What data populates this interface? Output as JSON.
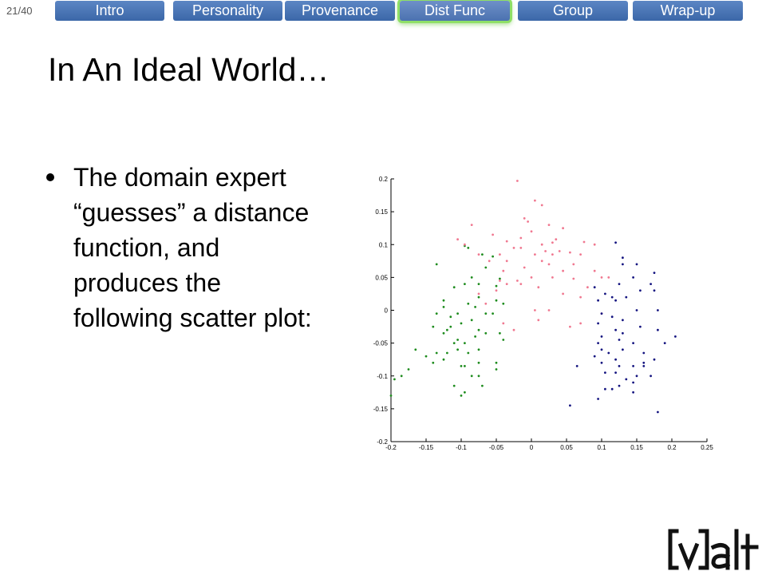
{
  "page_indicator": "21/40",
  "nav": {
    "tabs": [
      {
        "label": "Intro",
        "active": false
      },
      {
        "label": "Personality",
        "active": false
      },
      {
        "label": "Provenance",
        "active": false
      },
      {
        "label": "Dist Func",
        "active": true
      },
      {
        "label": "Group",
        "active": false
      },
      {
        "label": "Wrap-up",
        "active": false
      }
    ]
  },
  "slide": {
    "title": "In An Ideal World…",
    "bullets": [
      {
        "text": "The domain expert “guesses” a distance function, and produces the following scatter plot:"
      }
    ]
  },
  "logo": {
    "text": "[v]alt"
  },
  "colors": {
    "nav_tab": "#4a75b8",
    "nav_active_glow": "#8fdf66",
    "series_green": "#1e8c1e",
    "series_pink": "#f07890",
    "series_navy": "#141480"
  },
  "chart_data": {
    "type": "scatter",
    "title": "",
    "xlabel": "",
    "ylabel": "",
    "xlim": [
      -0.2,
      0.25
    ],
    "ylim": [
      -0.2,
      0.2
    ],
    "xticks": [
      "-0.2",
      "-0.15",
      "-0.1",
      "-0.05",
      "0",
      "0.05",
      "0.1",
      "0.15",
      "0.2",
      "0.25"
    ],
    "yticks": [
      "0.2",
      "0.15",
      "0.1",
      "0.05",
      "0",
      "-0.05",
      "-0.1",
      "-0.15",
      "-0.2"
    ],
    "grid": false,
    "series": [
      {
        "color": "#1e8c1e",
        "points": [
          [
            -0.095,
            0.098
          ],
          [
            -0.09,
            0.095
          ],
          [
            -0.07,
            0.085
          ],
          [
            -0.055,
            0.082
          ],
          [
            -0.135,
            0.07
          ],
          [
            -0.085,
            0.05
          ],
          [
            -0.045,
            0.048
          ],
          [
            -0.095,
            0.04
          ],
          [
            -0.075,
            0.04
          ],
          [
            -0.11,
            0.035
          ],
          [
            -0.05,
            0.037
          ],
          [
            -0.075,
            0.02
          ],
          [
            -0.08,
            0.005
          ],
          [
            -0.09,
            0.01
          ],
          [
            -0.125,
            0.015
          ],
          [
            -0.05,
            0.015
          ],
          [
            -0.04,
            0.01
          ],
          [
            -0.105,
            -0.005
          ],
          [
            -0.135,
            -0.005
          ],
          [
            -0.115,
            -0.01
          ],
          [
            -0.065,
            -0.005
          ],
          [
            -0.055,
            -0.005
          ],
          [
            -0.1,
            -0.02
          ],
          [
            -0.085,
            -0.015
          ],
          [
            -0.115,
            -0.025
          ],
          [
            -0.12,
            -0.03
          ],
          [
            -0.125,
            -0.035
          ],
          [
            -0.14,
            -0.025
          ],
          [
            -0.075,
            -0.03
          ],
          [
            -0.08,
            -0.04
          ],
          [
            -0.065,
            -0.035
          ],
          [
            -0.045,
            -0.035
          ],
          [
            -0.04,
            -0.045
          ],
          [
            -0.105,
            -0.045
          ],
          [
            -0.11,
            -0.05
          ],
          [
            -0.095,
            -0.05
          ],
          [
            -0.15,
            -0.07
          ],
          [
            -0.165,
            -0.06
          ],
          [
            -0.135,
            -0.065
          ],
          [
            -0.12,
            -0.065
          ],
          [
            -0.105,
            -0.06
          ],
          [
            -0.09,
            -0.065
          ],
          [
            -0.075,
            -0.06
          ],
          [
            -0.125,
            -0.075
          ],
          [
            -0.14,
            -0.08
          ],
          [
            -0.1,
            -0.085
          ],
          [
            -0.095,
            -0.085
          ],
          [
            -0.075,
            -0.08
          ],
          [
            -0.05,
            -0.08
          ],
          [
            -0.05,
            -0.09
          ],
          [
            -0.075,
            -0.1
          ],
          [
            -0.085,
            -0.1
          ],
          [
            -0.175,
            -0.09
          ],
          [
            -0.185,
            -0.1
          ],
          [
            -0.195,
            -0.105
          ],
          [
            -0.11,
            -0.115
          ],
          [
            -0.07,
            -0.115
          ],
          [
            -0.095,
            -0.125
          ],
          [
            -0.1,
            -0.13
          ],
          [
            -0.2,
            -0.13
          ],
          [
            -0.125,
            0.005
          ],
          [
            -0.065,
            0.065
          ]
        ]
      },
      {
        "color": "#f07890",
        "points": [
          [
            -0.02,
            0.197
          ],
          [
            0.005,
            0.167
          ],
          [
            0.015,
            0.16
          ],
          [
            -0.01,
            0.14
          ],
          [
            -0.005,
            0.135
          ],
          [
            0.025,
            0.13
          ],
          [
            0.045,
            0.125
          ],
          [
            -0.085,
            0.13
          ],
          [
            0.0,
            0.12
          ],
          [
            -0.055,
            0.115
          ],
          [
            -0.105,
            0.108
          ],
          [
            -0.035,
            0.105
          ],
          [
            -0.015,
            0.11
          ],
          [
            0.015,
            0.1
          ],
          [
            0.03,
            0.103
          ],
          [
            0.075,
            0.104
          ],
          [
            0.09,
            0.1
          ],
          [
            -0.095,
            0.1
          ],
          [
            -0.025,
            0.095
          ],
          [
            0.02,
            0.09
          ],
          [
            0.04,
            0.09
          ],
          [
            0.055,
            0.088
          ],
          [
            -0.075,
            0.085
          ],
          [
            -0.045,
            0.085
          ],
          [
            0.005,
            0.085
          ],
          [
            0.03,
            0.085
          ],
          [
            0.07,
            0.085
          ],
          [
            -0.06,
            0.075
          ],
          [
            -0.035,
            0.075
          ],
          [
            0.015,
            0.075
          ],
          [
            0.06,
            0.07
          ],
          [
            0.09,
            0.06
          ],
          [
            -0.04,
            0.06
          ],
          [
            -0.01,
            0.065
          ],
          [
            0.025,
            0.07
          ],
          [
            0.045,
            0.06
          ],
          [
            0.11,
            0.05
          ],
          [
            -0.02,
            0.045
          ],
          [
            -0.045,
            0.045
          ],
          [
            0.0,
            0.05
          ],
          [
            0.03,
            0.05
          ],
          [
            0.06,
            0.048
          ],
          [
            0.1,
            0.05
          ],
          [
            -0.035,
            0.04
          ],
          [
            -0.015,
            0.04
          ],
          [
            0.01,
            0.035
          ],
          [
            0.08,
            0.035
          ],
          [
            -0.05,
            0.03
          ],
          [
            -0.075,
            0.025
          ],
          [
            0.045,
            0.025
          ],
          [
            0.07,
            0.02
          ],
          [
            -0.065,
            0.01
          ],
          [
            0.005,
            0.0
          ],
          [
            0.025,
            0.0
          ],
          [
            0.1,
            -0.005
          ],
          [
            0.01,
            -0.015
          ],
          [
            -0.04,
            -0.02
          ],
          [
            -0.025,
            -0.03
          ],
          [
            0.055,
            -0.025
          ],
          [
            0.07,
            -0.02
          ],
          [
            -0.015,
            0.095
          ],
          [
            0.035,
            0.108
          ]
        ]
      },
      {
        "color": "#141480",
        "points": [
          [
            0.12,
            0.103
          ],
          [
            0.13,
            0.08
          ],
          [
            0.13,
            0.07
          ],
          [
            0.15,
            0.07
          ],
          [
            0.175,
            0.057
          ],
          [
            0.145,
            0.05
          ],
          [
            0.17,
            0.04
          ],
          [
            0.125,
            0.04
          ],
          [
            0.09,
            0.035
          ],
          [
            0.105,
            0.025
          ],
          [
            0.115,
            0.02
          ],
          [
            0.135,
            0.02
          ],
          [
            0.155,
            0.03
          ],
          [
            0.175,
            0.03
          ],
          [
            0.095,
            0.015
          ],
          [
            0.12,
            0.015
          ],
          [
            0.15,
            0.0
          ],
          [
            0.18,
            0.0
          ],
          [
            0.1,
            -0.005
          ],
          [
            0.115,
            -0.01
          ],
          [
            0.13,
            -0.015
          ],
          [
            0.095,
            -0.02
          ],
          [
            0.155,
            -0.025
          ],
          [
            0.18,
            -0.03
          ],
          [
            0.12,
            -0.03
          ],
          [
            0.205,
            -0.04
          ],
          [
            0.1,
            -0.04
          ],
          [
            0.125,
            -0.045
          ],
          [
            0.145,
            -0.05
          ],
          [
            0.095,
            -0.05
          ],
          [
            0.19,
            -0.05
          ],
          [
            0.1,
            -0.06
          ],
          [
            0.13,
            -0.06
          ],
          [
            0.16,
            -0.065
          ],
          [
            0.11,
            -0.065
          ],
          [
            0.175,
            -0.075
          ],
          [
            0.09,
            -0.07
          ],
          [
            0.12,
            -0.075
          ],
          [
            0.1,
            -0.08
          ],
          [
            0.16,
            -0.085
          ],
          [
            0.125,
            -0.085
          ],
          [
            0.145,
            -0.085
          ],
          [
            0.065,
            -0.085
          ],
          [
            0.15,
            -0.1
          ],
          [
            0.17,
            -0.1
          ],
          [
            0.12,
            -0.095
          ],
          [
            0.105,
            -0.095
          ],
          [
            0.135,
            -0.105
          ],
          [
            0.145,
            -0.11
          ],
          [
            0.125,
            -0.115
          ],
          [
            0.105,
            -0.12
          ],
          [
            0.115,
            -0.12
          ],
          [
            0.145,
            -0.125
          ],
          [
            0.055,
            -0.145
          ],
          [
            0.095,
            -0.135
          ],
          [
            0.18,
            -0.155
          ],
          [
            0.16,
            -0.08
          ],
          [
            0.13,
            -0.035
          ]
        ]
      }
    ]
  }
}
